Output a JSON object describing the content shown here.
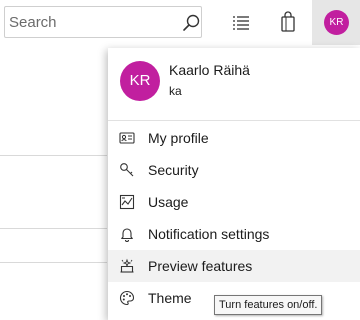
{
  "search": {
    "placeholder": "Search"
  },
  "top_icons": [
    "search-icon",
    "list-icon",
    "shopping-bag-icon"
  ],
  "account": {
    "initials": "KR",
    "name": "Kaarlo Räihä",
    "id": "ka",
    "avatar_color": "#c11f9f"
  },
  "menu": {
    "items": [
      {
        "label": "My profile",
        "icon": "contact-card-icon"
      },
      {
        "label": "Security",
        "icon": "key-icon"
      },
      {
        "label": "Usage",
        "icon": "chart-icon"
      },
      {
        "label": "Notification settings",
        "icon": "bell-icon"
      },
      {
        "label": "Preview features",
        "icon": "sparkle-icon"
      },
      {
        "label": "Theme",
        "icon": "palette-icon"
      }
    ]
  },
  "tooltip": {
    "text": "Turn features on/off."
  }
}
